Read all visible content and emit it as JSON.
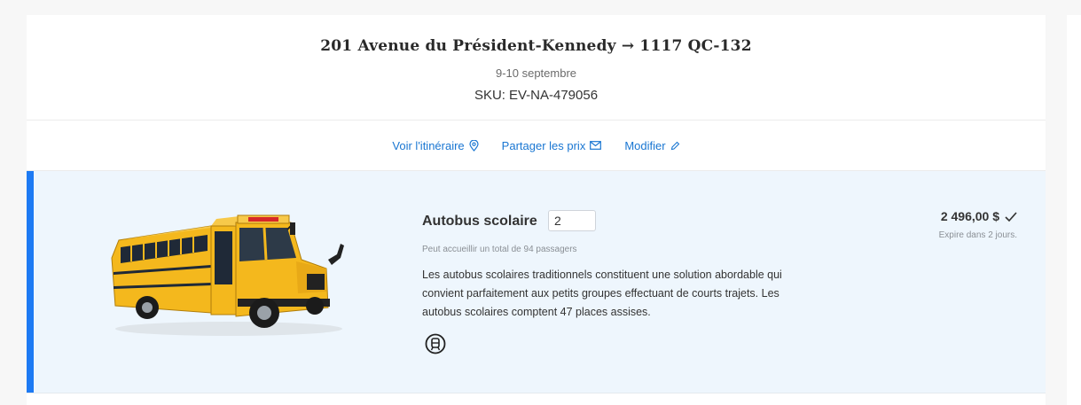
{
  "trip": {
    "route": "201 Avenue du Président-Kennedy → 1117 QC-132",
    "dates": "9-10 septembre",
    "sku_label": "SKU:",
    "sku_value": "EV-NA-479056"
  },
  "actions": {
    "itinerary": "Voir l'itinéraire",
    "share": "Partager les prix",
    "edit": "Modifier"
  },
  "quote": {
    "vehicle_name": "Autobus scolaire",
    "quantity": "2",
    "capacity": "Peut accueillir un total de 94 passagers",
    "description": "Les autobus scolaires traditionnels constituent une solution abordable qui convient parfaitement aux petits groupes effectuant de courts trajets. Les autobus scolaires comptent 47 places assises.",
    "price": "2 496,00 $",
    "expiry": "Expire dans 2 jours.",
    "amenity_icon": "transit-icon"
  },
  "colors": {
    "accent": "#1d7af3",
    "link": "#1976d2",
    "quote_bg": "#eef6fd"
  }
}
